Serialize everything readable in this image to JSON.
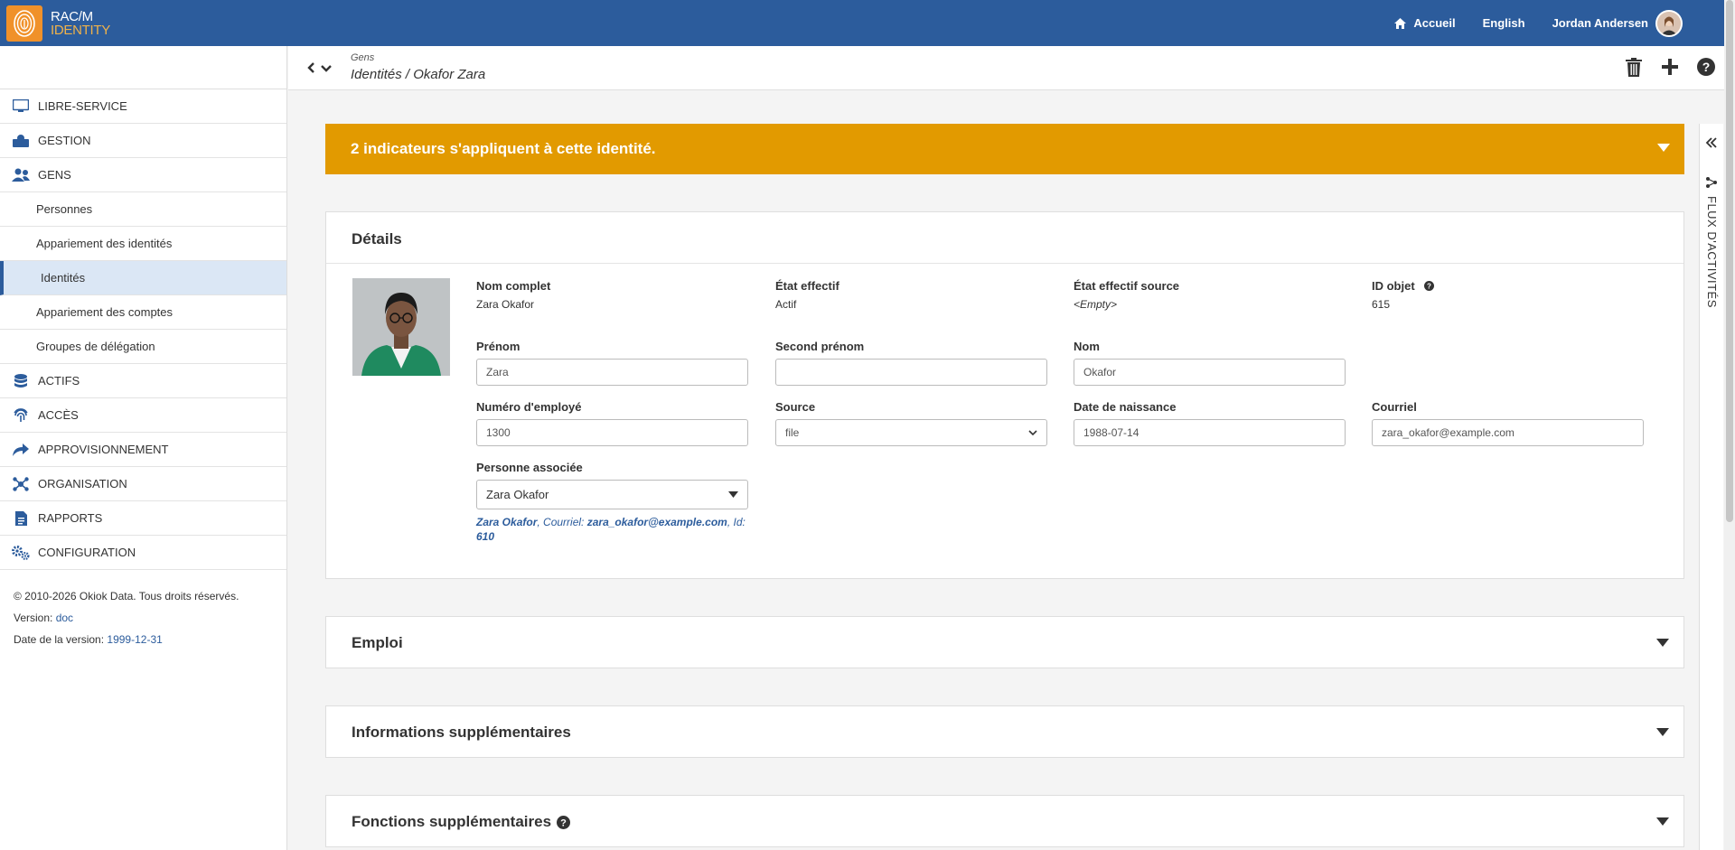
{
  "brand": {
    "line1": "RAC/M",
    "line2": "IDENTITY"
  },
  "topnav": {
    "home": "Accueil",
    "language": "English",
    "user": "Jordan Andersen"
  },
  "sidebar": {
    "items": [
      {
        "label": "LIBRE-SERVICE",
        "icon": "monitor-icon"
      },
      {
        "label": "GESTION",
        "icon": "management-icon"
      },
      {
        "label": "GENS",
        "icon": "people-icon"
      }
    ],
    "subitems": [
      "Personnes",
      "Appariement des identités",
      "Identités",
      "Appariement des comptes",
      "Groupes de délégation"
    ],
    "active_subitem": "Identités",
    "items_after": [
      {
        "label": "ACTIFS",
        "icon": "database-icon"
      },
      {
        "label": "ACCÈS",
        "icon": "fingerprint-icon"
      },
      {
        "label": "APPROVISIONNEMENT",
        "icon": "share-icon"
      },
      {
        "label": "ORGANISATION",
        "icon": "network-icon"
      },
      {
        "label": "RAPPORTS",
        "icon": "report-icon"
      },
      {
        "label": "CONFIGURATION",
        "icon": "gears-icon"
      }
    ],
    "footer": {
      "copyright": "© 2010-2026 Okiok Data. Tous droits réservés.",
      "version_label": "Version:",
      "version_value": "doc",
      "date_label": "Date de la version:",
      "date_value": "1999-12-31"
    }
  },
  "breadcrumb": {
    "section": "Gens",
    "path": "Identités / Okafor Zara"
  },
  "rail": {
    "label": "FLUX D'ACTIVITÉS"
  },
  "banner": {
    "text": "2 indicateurs s'appliquent à cette identité."
  },
  "details": {
    "title": "Détails",
    "full_name_label": "Nom complet",
    "full_name": "Zara Okafor",
    "state_label": "État effectif",
    "state": "Actif",
    "state_source_label": "État effectif source",
    "state_source": "<Empty>",
    "object_id_label": "ID objet",
    "object_id": "615",
    "first_name_label": "Prénom",
    "first_name": "Zara",
    "middle_name_label": "Second prénom",
    "middle_name": "",
    "last_name_label": "Nom",
    "last_name": "Okafor",
    "employee_label": "Numéro d'employé",
    "employee": "1300",
    "source_label": "Source",
    "source": "file",
    "birth_label": "Date de naissance",
    "birth": "1988-07-14",
    "email_label": "Courriel",
    "email": "zara_okafor@example.com",
    "assoc_label": "Personne associée",
    "assoc": "Zara Okafor",
    "assoc_note": {
      "name": "Zara Okafor",
      "email_label": ", Courriel: ",
      "email": "zara_okafor@example.com",
      "id_label": ", Id: ",
      "id": "610"
    }
  },
  "sections": [
    "Emploi",
    "Informations supplémentaires",
    "Fonctions supplémentaires"
  ],
  "colors": {
    "topbar": "#2c5c9c",
    "banner": "#e29a00",
    "accent": "#f0912a"
  }
}
